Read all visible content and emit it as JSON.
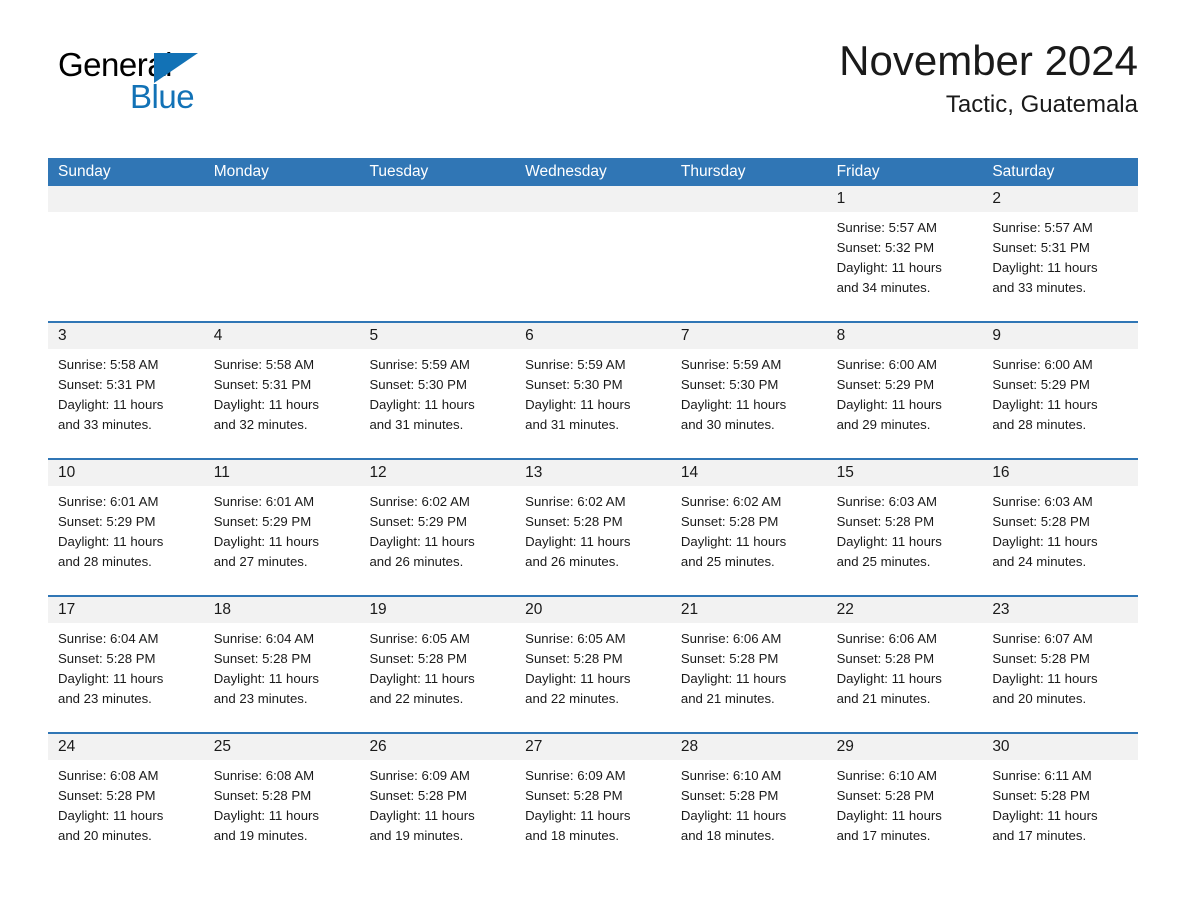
{
  "brand": {
    "name_part1": "General",
    "name_part2": "Blue",
    "color_dark": "#000000",
    "color_blue": "#1272b6"
  },
  "header": {
    "month_title": "November 2024",
    "location": "Tactic, Guatemala"
  },
  "theme": {
    "header_blue": "#3076b5",
    "row_separator_blue": "#3076b5",
    "date_band_gray": "#f2f2f2",
    "text_dark": "#1a1a1a"
  },
  "weekdays": [
    "Sunday",
    "Monday",
    "Tuesday",
    "Wednesday",
    "Thursday",
    "Friday",
    "Saturday"
  ],
  "weeks": [
    {
      "days": [
        {
          "date": "",
          "empty": true,
          "sunrise": "",
          "sunset": "",
          "daylight_line1": "",
          "daylight_line2": ""
        },
        {
          "date": "",
          "empty": true,
          "sunrise": "",
          "sunset": "",
          "daylight_line1": "",
          "daylight_line2": ""
        },
        {
          "date": "",
          "empty": true,
          "sunrise": "",
          "sunset": "",
          "daylight_line1": "",
          "daylight_line2": ""
        },
        {
          "date": "",
          "empty": true,
          "sunrise": "",
          "sunset": "",
          "daylight_line1": "",
          "daylight_line2": ""
        },
        {
          "date": "",
          "empty": true,
          "sunrise": "",
          "sunset": "",
          "daylight_line1": "",
          "daylight_line2": ""
        },
        {
          "date": "1",
          "empty": false,
          "sunrise": "Sunrise: 5:57 AM",
          "sunset": "Sunset: 5:32 PM",
          "daylight_line1": "Daylight: 11 hours",
          "daylight_line2": "and 34 minutes."
        },
        {
          "date": "2",
          "empty": false,
          "sunrise": "Sunrise: 5:57 AM",
          "sunset": "Sunset: 5:31 PM",
          "daylight_line1": "Daylight: 11 hours",
          "daylight_line2": "and 33 minutes."
        }
      ]
    },
    {
      "days": [
        {
          "date": "3",
          "empty": false,
          "sunrise": "Sunrise: 5:58 AM",
          "sunset": "Sunset: 5:31 PM",
          "daylight_line1": "Daylight: 11 hours",
          "daylight_line2": "and 33 minutes."
        },
        {
          "date": "4",
          "empty": false,
          "sunrise": "Sunrise: 5:58 AM",
          "sunset": "Sunset: 5:31 PM",
          "daylight_line1": "Daylight: 11 hours",
          "daylight_line2": "and 32 minutes."
        },
        {
          "date": "5",
          "empty": false,
          "sunrise": "Sunrise: 5:59 AM",
          "sunset": "Sunset: 5:30 PM",
          "daylight_line1": "Daylight: 11 hours",
          "daylight_line2": "and 31 minutes."
        },
        {
          "date": "6",
          "empty": false,
          "sunrise": "Sunrise: 5:59 AM",
          "sunset": "Sunset: 5:30 PM",
          "daylight_line1": "Daylight: 11 hours",
          "daylight_line2": "and 31 minutes."
        },
        {
          "date": "7",
          "empty": false,
          "sunrise": "Sunrise: 5:59 AM",
          "sunset": "Sunset: 5:30 PM",
          "daylight_line1": "Daylight: 11 hours",
          "daylight_line2": "and 30 minutes."
        },
        {
          "date": "8",
          "empty": false,
          "sunrise": "Sunrise: 6:00 AM",
          "sunset": "Sunset: 5:29 PM",
          "daylight_line1": "Daylight: 11 hours",
          "daylight_line2": "and 29 minutes."
        },
        {
          "date": "9",
          "empty": false,
          "sunrise": "Sunrise: 6:00 AM",
          "sunset": "Sunset: 5:29 PM",
          "daylight_line1": "Daylight: 11 hours",
          "daylight_line2": "and 28 minutes."
        }
      ]
    },
    {
      "days": [
        {
          "date": "10",
          "empty": false,
          "sunrise": "Sunrise: 6:01 AM",
          "sunset": "Sunset: 5:29 PM",
          "daylight_line1": "Daylight: 11 hours",
          "daylight_line2": "and 28 minutes."
        },
        {
          "date": "11",
          "empty": false,
          "sunrise": "Sunrise: 6:01 AM",
          "sunset": "Sunset: 5:29 PM",
          "daylight_line1": "Daylight: 11 hours",
          "daylight_line2": "and 27 minutes."
        },
        {
          "date": "12",
          "empty": false,
          "sunrise": "Sunrise: 6:02 AM",
          "sunset": "Sunset: 5:29 PM",
          "daylight_line1": "Daylight: 11 hours",
          "daylight_line2": "and 26 minutes."
        },
        {
          "date": "13",
          "empty": false,
          "sunrise": "Sunrise: 6:02 AM",
          "sunset": "Sunset: 5:28 PM",
          "daylight_line1": "Daylight: 11 hours",
          "daylight_line2": "and 26 minutes."
        },
        {
          "date": "14",
          "empty": false,
          "sunrise": "Sunrise: 6:02 AM",
          "sunset": "Sunset: 5:28 PM",
          "daylight_line1": "Daylight: 11 hours",
          "daylight_line2": "and 25 minutes."
        },
        {
          "date": "15",
          "empty": false,
          "sunrise": "Sunrise: 6:03 AM",
          "sunset": "Sunset: 5:28 PM",
          "daylight_line1": "Daylight: 11 hours",
          "daylight_line2": "and 25 minutes."
        },
        {
          "date": "16",
          "empty": false,
          "sunrise": "Sunrise: 6:03 AM",
          "sunset": "Sunset: 5:28 PM",
          "daylight_line1": "Daylight: 11 hours",
          "daylight_line2": "and 24 minutes."
        }
      ]
    },
    {
      "days": [
        {
          "date": "17",
          "empty": false,
          "sunrise": "Sunrise: 6:04 AM",
          "sunset": "Sunset: 5:28 PM",
          "daylight_line1": "Daylight: 11 hours",
          "daylight_line2": "and 23 minutes."
        },
        {
          "date": "18",
          "empty": false,
          "sunrise": "Sunrise: 6:04 AM",
          "sunset": "Sunset: 5:28 PM",
          "daylight_line1": "Daylight: 11 hours",
          "daylight_line2": "and 23 minutes."
        },
        {
          "date": "19",
          "empty": false,
          "sunrise": "Sunrise: 6:05 AM",
          "sunset": "Sunset: 5:28 PM",
          "daylight_line1": "Daylight: 11 hours",
          "daylight_line2": "and 22 minutes."
        },
        {
          "date": "20",
          "empty": false,
          "sunrise": "Sunrise: 6:05 AM",
          "sunset": "Sunset: 5:28 PM",
          "daylight_line1": "Daylight: 11 hours",
          "daylight_line2": "and 22 minutes."
        },
        {
          "date": "21",
          "empty": false,
          "sunrise": "Sunrise: 6:06 AM",
          "sunset": "Sunset: 5:28 PM",
          "daylight_line1": "Daylight: 11 hours",
          "daylight_line2": "and 21 minutes."
        },
        {
          "date": "22",
          "empty": false,
          "sunrise": "Sunrise: 6:06 AM",
          "sunset": "Sunset: 5:28 PM",
          "daylight_line1": "Daylight: 11 hours",
          "daylight_line2": "and 21 minutes."
        },
        {
          "date": "23",
          "empty": false,
          "sunrise": "Sunrise: 6:07 AM",
          "sunset": "Sunset: 5:28 PM",
          "daylight_line1": "Daylight: 11 hours",
          "daylight_line2": "and 20 minutes."
        }
      ]
    },
    {
      "days": [
        {
          "date": "24",
          "empty": false,
          "sunrise": "Sunrise: 6:08 AM",
          "sunset": "Sunset: 5:28 PM",
          "daylight_line1": "Daylight: 11 hours",
          "daylight_line2": "and 20 minutes."
        },
        {
          "date": "25",
          "empty": false,
          "sunrise": "Sunrise: 6:08 AM",
          "sunset": "Sunset: 5:28 PM",
          "daylight_line1": "Daylight: 11 hours",
          "daylight_line2": "and 19 minutes."
        },
        {
          "date": "26",
          "empty": false,
          "sunrise": "Sunrise: 6:09 AM",
          "sunset": "Sunset: 5:28 PM",
          "daylight_line1": "Daylight: 11 hours",
          "daylight_line2": "and 19 minutes."
        },
        {
          "date": "27",
          "empty": false,
          "sunrise": "Sunrise: 6:09 AM",
          "sunset": "Sunset: 5:28 PM",
          "daylight_line1": "Daylight: 11 hours",
          "daylight_line2": "and 18 minutes."
        },
        {
          "date": "28",
          "empty": false,
          "sunrise": "Sunrise: 6:10 AM",
          "sunset": "Sunset: 5:28 PM",
          "daylight_line1": "Daylight: 11 hours",
          "daylight_line2": "and 18 minutes."
        },
        {
          "date": "29",
          "empty": false,
          "sunrise": "Sunrise: 6:10 AM",
          "sunset": "Sunset: 5:28 PM",
          "daylight_line1": "Daylight: 11 hours",
          "daylight_line2": "and 17 minutes."
        },
        {
          "date": "30",
          "empty": false,
          "sunrise": "Sunrise: 6:11 AM",
          "sunset": "Sunset: 5:28 PM",
          "daylight_line1": "Daylight: 11 hours",
          "daylight_line2": "and 17 minutes."
        }
      ]
    }
  ]
}
